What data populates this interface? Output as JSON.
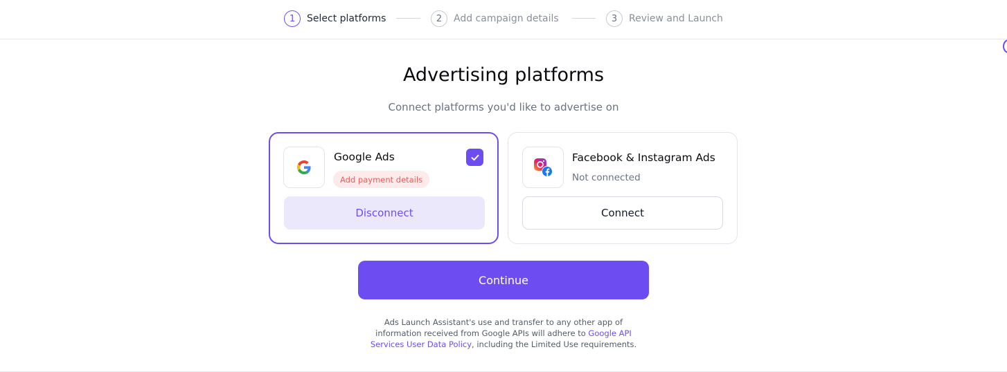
{
  "stepper": {
    "steps": [
      {
        "number": "1",
        "label": "Select platforms",
        "state": "active"
      },
      {
        "number": "2",
        "label": "Add campaign details",
        "state": "inactive"
      },
      {
        "number": "3",
        "label": "Review and Launch",
        "state": "inactive"
      }
    ]
  },
  "main": {
    "title": "Advertising platforms",
    "subtitle": "Connect platforms you'd like to advertise on"
  },
  "platforms": {
    "google": {
      "name": "Google Ads",
      "badge": "Add payment details",
      "button_label": "Disconnect",
      "selected": true,
      "icon": "google-logo-icon"
    },
    "facebook": {
      "name": "Facebook & Instagram Ads",
      "status": "Not connected",
      "button_label": "Connect",
      "selected": false,
      "icon": "instagram-facebook-logo-icon"
    }
  },
  "actions": {
    "continue_label": "Continue"
  },
  "legal": {
    "text_before": "Ads Launch Assistant's use and transfer to any other app of information received from Google APIs will adhere to ",
    "link_text": "Google API Services User Data Policy",
    "text_after": ", including the Limited Use requirements."
  },
  "colors": {
    "accent": "#6d4df2",
    "accent_soft": "#ece8fc",
    "badge_bg": "#fdeaea",
    "badge_text": "#ef5b5b"
  }
}
